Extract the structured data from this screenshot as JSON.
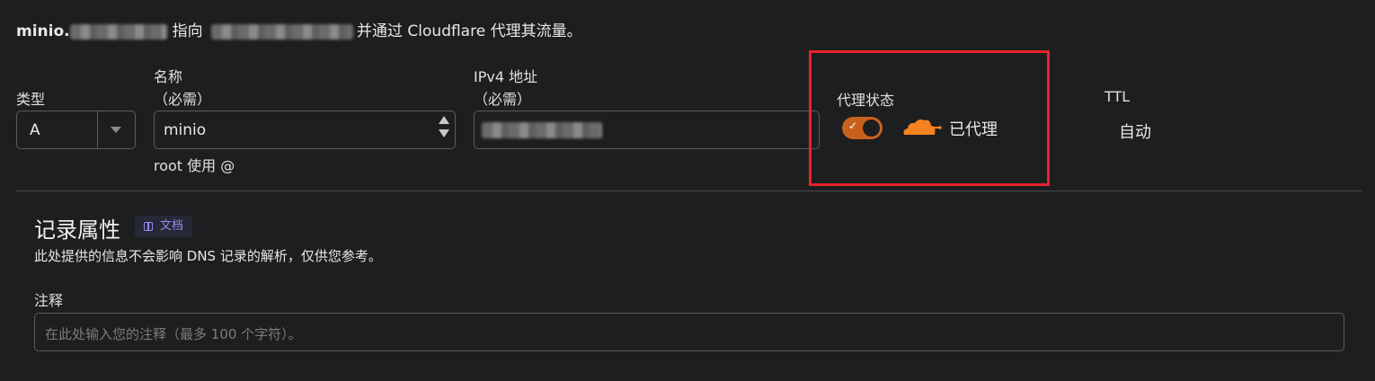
{
  "summary": {
    "host_prefix": "minio.",
    "points_to": "指向",
    "proxy_text": "并通过 Cloudflare 代理其流量。"
  },
  "fields": {
    "type": {
      "label": "类型",
      "value": "A"
    },
    "name": {
      "label": "名称",
      "required": "（必需）",
      "value": "minio",
      "hint": "root 使用 @"
    },
    "ipv4": {
      "label": "IPv4 地址",
      "required": "（必需）"
    },
    "proxy": {
      "label": "代理状态",
      "status": "已代理",
      "enabled": true
    },
    "ttl": {
      "label": "TTL",
      "value": "自动"
    }
  },
  "record_attrs": {
    "title": "记录属性",
    "docs_badge": "文档",
    "description": "此处提供的信息不会影响 DNS 记录的解析，仅供您参考。",
    "comment_label": "注释",
    "comment_placeholder": "在此处输入您的注释（最多 100 个字符）。"
  },
  "colors": {
    "background": "#1d1e20",
    "accent_orange": "#f6821f",
    "toggle_on": "#c8611b",
    "highlight_red": "#e8222b",
    "badge_text": "#8f8dea"
  }
}
